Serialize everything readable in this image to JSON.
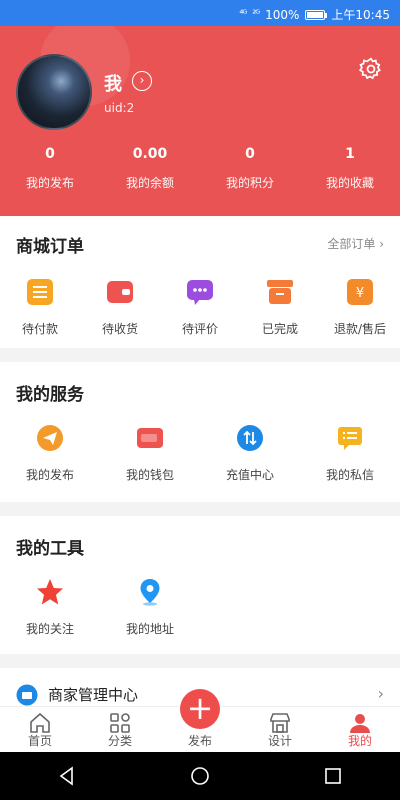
{
  "status_bar": {
    "signal_1": "⁴ᴳ",
    "signal_2": "²ᴳ",
    "battery": "100%",
    "time": "上午10:45"
  },
  "profile": {
    "name": "我",
    "uid": "uid:2",
    "stats": [
      {
        "value": "0",
        "label": "我的发布"
      },
      {
        "value": "0.00",
        "label": "我的余额"
      },
      {
        "value": "0",
        "label": "我的积分"
      },
      {
        "value": "1",
        "label": "我的收藏"
      }
    ]
  },
  "orders": {
    "title": "商城订单",
    "all_link": "全部订单",
    "items": [
      {
        "label": "待付款",
        "icon": "list-icon",
        "color": "#f6a623"
      },
      {
        "label": "待收货",
        "icon": "wallet-icon",
        "color": "#ef5350"
      },
      {
        "label": "待评价",
        "icon": "chat-icon",
        "color": "#9c4de0"
      },
      {
        "label": "已完成",
        "icon": "box-icon",
        "color": "#f47a3a"
      },
      {
        "label": "退款/售后",
        "icon": "yen-icon",
        "color": "#f48b2a"
      }
    ]
  },
  "services": {
    "title": "我的服务",
    "items": [
      {
        "label": "我的发布",
        "icon": "send-icon",
        "color": "#f39a2a"
      },
      {
        "label": "我的钱包",
        "icon": "wallet-icon",
        "color": "#ef5350"
      },
      {
        "label": "充值中心",
        "icon": "exchange-icon",
        "color": "#1e88e5"
      },
      {
        "label": "我的私信",
        "icon": "message-icon",
        "color": "#f6b21f"
      }
    ]
  },
  "tools": {
    "title": "我的工具",
    "items": [
      {
        "label": "我的关注",
        "icon": "star-icon",
        "color": "#ef4135"
      },
      {
        "label": "我的地址",
        "icon": "location-icon",
        "color": "#2196f3"
      }
    ]
  },
  "merchant": {
    "label": "商家管理中心"
  },
  "bottom_nav": [
    {
      "label": "首页",
      "icon": "home-icon"
    },
    {
      "label": "分类",
      "icon": "category-icon"
    },
    {
      "label": "发布",
      "icon": "plus-icon"
    },
    {
      "label": "设计",
      "icon": "store-icon"
    },
    {
      "label": "我的",
      "icon": "user-icon"
    }
  ],
  "colors": {
    "primary": "#ea5353",
    "status_bar": "#2f80ed",
    "active_tab": "#e94c4c"
  }
}
